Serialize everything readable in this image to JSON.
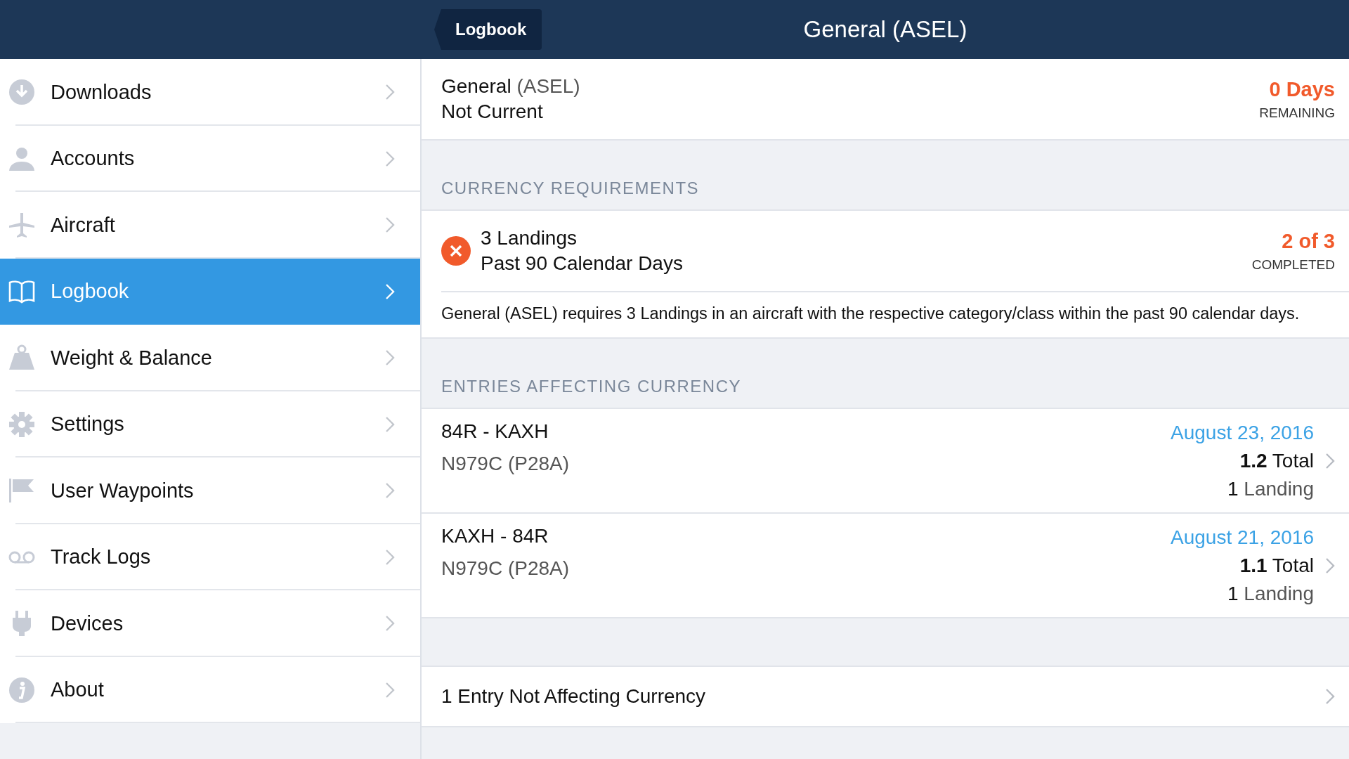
{
  "header": {
    "back_button": "Logbook",
    "title": "General (ASEL)"
  },
  "sidebar": {
    "items": [
      {
        "label": "Downloads",
        "selected": false
      },
      {
        "label": "Accounts",
        "selected": false
      },
      {
        "label": "Aircraft",
        "selected": false
      },
      {
        "label": "Logbook",
        "selected": true
      },
      {
        "label": "Weight & Balance",
        "selected": false
      },
      {
        "label": "Settings",
        "selected": false
      },
      {
        "label": "User Waypoints",
        "selected": false
      },
      {
        "label": "Track Logs",
        "selected": false
      },
      {
        "label": "Devices",
        "selected": false
      },
      {
        "label": "About",
        "selected": false
      }
    ]
  },
  "summary": {
    "name": "General",
    "qualifier": "(ASEL)",
    "status": "Not Current",
    "value": "0 Days",
    "value_label": "REMAINING"
  },
  "requirements": {
    "heading": "CURRENCY REQUIREMENTS",
    "items": [
      {
        "met": false,
        "title": "3 Landings",
        "subtitle": "Past 90 Calendar Days",
        "value": "2 of 3",
        "value_label": "COMPLETED",
        "description": "General (ASEL) requires 3 Landings in an aircraft with the respective category/class within the past 90 calendar days."
      }
    ]
  },
  "entries": {
    "heading": "ENTRIES AFFECTING CURRENCY",
    "items": [
      {
        "route": "84R - KAXH",
        "aircraft": "N979C (P28A)",
        "date": "August 23, 2016",
        "total": "**1.2** Total",
        "landings": "**1** Landing"
      },
      {
        "route": "KAXH - 84R",
        "aircraft": "N979C (P28A)",
        "date": "August 21, 2016",
        "total": "**1.1** Total",
        "landings": "**1** Landing"
      }
    ]
  },
  "other_entries": "1 Entry Not Affecting Currency"
}
